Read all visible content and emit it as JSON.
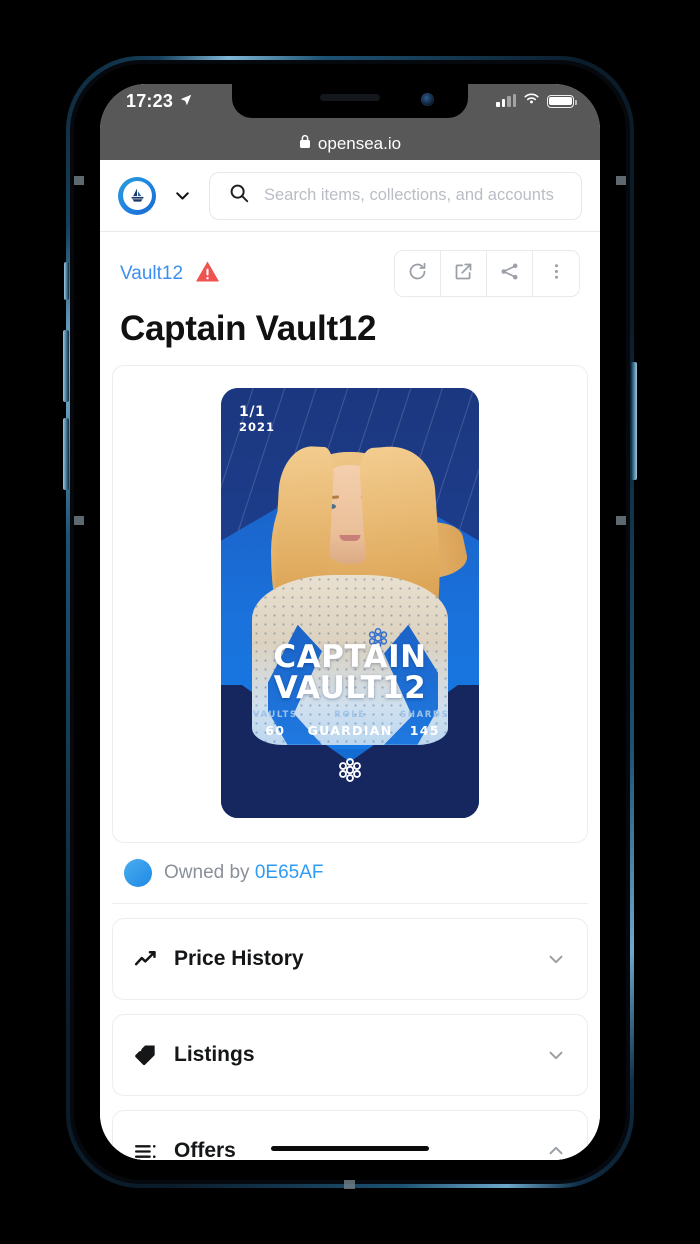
{
  "status_bar": {
    "time": "17:23",
    "location_icon": "location-arrow-icon",
    "signal_icon": "cellular-signal-icon",
    "wifi_icon": "wifi-icon",
    "battery_icon": "battery-icon"
  },
  "browser": {
    "lock_icon": "lock-icon",
    "url": "opensea.io"
  },
  "header": {
    "logo_name": "opensea-logo",
    "logo_chevron": "chevron-down-icon",
    "search": {
      "icon": "search-icon",
      "placeholder": "Search items, collections, and accounts",
      "value": ""
    }
  },
  "breadcrumb": {
    "collection": "Vault12",
    "warning_icon": "warning-triangle-icon",
    "actions": [
      {
        "name": "refresh-metadata-button",
        "icon": "refresh-icon"
      },
      {
        "name": "open-external-button",
        "icon": "external-link-icon"
      },
      {
        "name": "share-button",
        "icon": "share-icon"
      },
      {
        "name": "more-options-button",
        "icon": "more-vertical-icon"
      }
    ]
  },
  "item": {
    "title": "Captain Vault12"
  },
  "nft_card": {
    "edition": "1/1",
    "year": "2021",
    "name_line1": "CAPTAIN",
    "name_line2": "VAULT12",
    "stats": [
      {
        "label": "VAULTS",
        "value": "60"
      },
      {
        "label": "ROLE",
        "value": "GUARDIAN"
      },
      {
        "label": "SHARDS",
        "value": "145"
      }
    ],
    "footer_logo": "vault12-hex-logo"
  },
  "owner": {
    "avatar": "owner-avatar",
    "prefix": "Owned by",
    "address": "0E65AF"
  },
  "sections": [
    {
      "label": "Price History",
      "icon": "line-chart-icon",
      "chevron": "chevron-down-icon",
      "expanded": false
    },
    {
      "label": "Listings",
      "icon": "price-tag-icon",
      "chevron": "chevron-down-icon",
      "expanded": false
    },
    {
      "label": "Offers",
      "icon": "list-icon",
      "chevron": "chevron-up-icon",
      "expanded": true
    }
  ],
  "colors": {
    "link_blue": "#3b8ff0",
    "accent_blue": "#2081e2",
    "warning_red": "#ef4b4b",
    "card_navy": "#1b377f",
    "card_blue": "#1478e3"
  }
}
